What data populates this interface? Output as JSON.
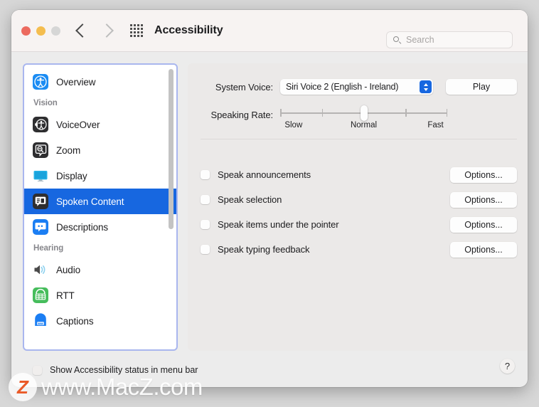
{
  "window": {
    "title": "Accessibility",
    "traffic_lights": [
      "close",
      "minimize",
      "zoom"
    ],
    "nav": {
      "back": "back-chevron",
      "forward": "forward-chevron"
    },
    "show_all_icon": "grid-icon"
  },
  "search": {
    "placeholder": "Search",
    "icon": "search-icon",
    "value": ""
  },
  "sidebar": {
    "scroll_thumb_icon": "vertical-scrollbar",
    "items": [
      {
        "label": "Overview",
        "icon": "accessibility-person-icon",
        "type": "item",
        "selected": false
      },
      {
        "label": "Vision",
        "icon": "",
        "type": "group",
        "selected": false
      },
      {
        "label": "VoiceOver",
        "icon": "voiceover-icon",
        "type": "item",
        "selected": false
      },
      {
        "label": "Zoom",
        "icon": "zoom-magnifier-icon",
        "type": "item",
        "selected": false
      },
      {
        "label": "Display",
        "icon": "display-monitor-icon",
        "type": "item",
        "selected": false
      },
      {
        "label": "Spoken Content",
        "icon": "spoken-content-icon",
        "type": "item",
        "selected": true
      },
      {
        "label": "Descriptions",
        "icon": "descriptions-icon",
        "type": "item",
        "selected": false
      },
      {
        "label": "Hearing",
        "icon": "",
        "type": "group",
        "selected": false
      },
      {
        "label": "Audio",
        "icon": "audio-speaker-icon",
        "type": "item",
        "selected": false
      },
      {
        "label": "RTT",
        "icon": "rtt-keypad-icon",
        "type": "item",
        "selected": false
      },
      {
        "label": "Captions",
        "icon": "captions-icon",
        "type": "item",
        "selected": false
      }
    ]
  },
  "main": {
    "system_voice": {
      "label": "System Voice:",
      "value": "Siri Voice 2 (English - Ireland)",
      "play_label": "Play"
    },
    "speaking_rate": {
      "label": "Speaking Rate:",
      "ticks": [
        "Slow",
        "Normal",
        "Fast"
      ],
      "position_percent": 50
    },
    "checkboxes": [
      {
        "label": "Speak announcements",
        "checked": false,
        "button": "Options..."
      },
      {
        "label": "Speak selection",
        "checked": false,
        "button": "Options..."
      },
      {
        "label": "Speak items under the pointer",
        "checked": false,
        "button": "Options..."
      },
      {
        "label": "Speak typing feedback",
        "checked": false,
        "button": "Options..."
      }
    ]
  },
  "footer": {
    "menu_bar_label": "Show Accessibility status in menu bar",
    "menu_bar_checked": false,
    "help_label": "?"
  },
  "watermark": {
    "logo_letter": "Z",
    "text": "www.MacZ.com"
  },
  "colors": {
    "accent": "#1767e0",
    "focus_ring": "#a9b6ee",
    "titlebar": "#f7f3f2",
    "pane": "#ebe9e8",
    "watermark_orange": "#ea5a28"
  }
}
